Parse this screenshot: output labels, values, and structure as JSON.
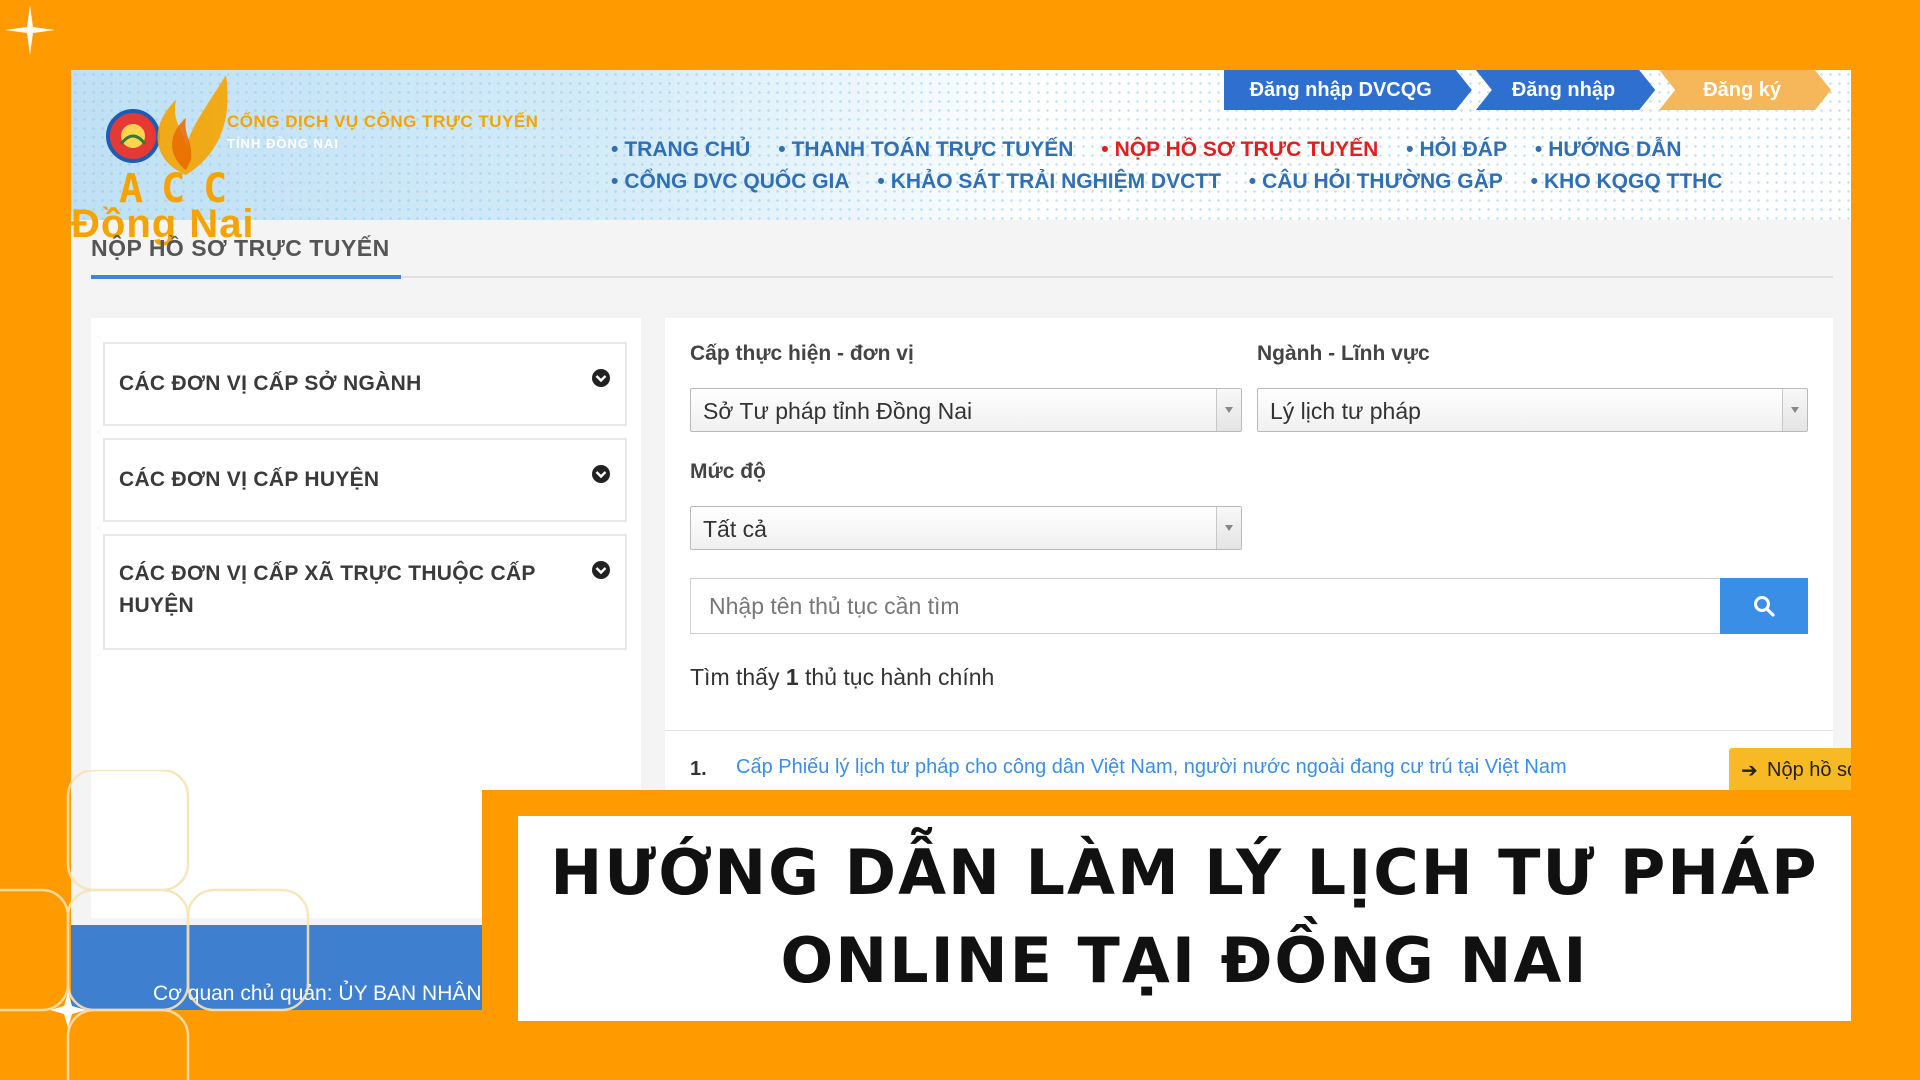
{
  "brand": {
    "portal_name": "CỔNG DỊCH VỤ CÔNG TRỰC TUYẾN",
    "portal_sub": "TỈNH ĐỒNG NAI",
    "watermark_line1": "ACC",
    "watermark_line2": "Đồng Nai",
    "accent_orange": "#ff9a00",
    "link_blue": "#2f6fb5"
  },
  "auth": {
    "login_dvcqg": "Đăng nhập DVCQG",
    "login": "Đăng nhập",
    "register": "Đăng ký"
  },
  "nav": {
    "row1": [
      {
        "label": "TRANG CHỦ"
      },
      {
        "label": "THANH TOÁN TRỰC TUYẾN"
      },
      {
        "label": "NỘP HỒ SƠ TRỰC TUYẾN",
        "active": true
      },
      {
        "label": "HỎI ĐÁP"
      },
      {
        "label": "HƯỚNG DẪN"
      }
    ],
    "row2": [
      {
        "label": "CỔNG DVC QUỐC GIA"
      },
      {
        "label": "KHẢO SÁT TRẢI NGHIỆM DVCTT"
      },
      {
        "label": "CÂU HỎI THƯỜNG GẶP"
      },
      {
        "label": "KHO KQGQ TTHC"
      }
    ]
  },
  "page": {
    "title": "NỘP HỒ SƠ TRỰC TUYẾN"
  },
  "units": [
    {
      "label": "CÁC ĐƠN VỊ CẤP SỞ NGÀNH",
      "icon": "chevron-circle-down-icon"
    },
    {
      "label": "CÁC ĐƠN VỊ CẤP HUYỆN",
      "icon": "chevron-circle-down-icon"
    },
    {
      "label": "CÁC ĐƠN VỊ CẤP XÃ TRỰC THUỘC CẤP HUYỆN",
      "icon": "chevron-circle-down-icon"
    }
  ],
  "filters": {
    "level_label": "Cấp thực hiện - đơn vị",
    "level_value": "Sở Tư pháp tỉnh Đồng Nai",
    "field_label": "Ngành - Lĩnh vực",
    "field_value": "Lý lịch tư pháp",
    "degree_label": "Mức độ",
    "degree_value": "Tất cả"
  },
  "search": {
    "placeholder": "Nhập tên thủ tục cần tìm",
    "icon": "search-icon"
  },
  "results": {
    "prefix": "Tìm thấy",
    "count": "1",
    "suffix": "thủ tục hành chính",
    "items": [
      {
        "index": "1.",
        "title": "Cấp Phiếu lý lịch tư pháp cho công dân Việt Nam, người nước ngoài đang cư trú tại Việt Nam",
        "action_label": "Nộp hồ sơ",
        "action_icon": "arrow-right-icon"
      }
    ]
  },
  "footer": {
    "text": "Cơ quan chủ quản: ỦY BAN NHÂN"
  },
  "caption": {
    "line1": "HƯỚNG DẪN LÀM LÝ LỊCH TƯ PHÁP",
    "line2": "ONLINE TẠI ĐỒNG NAI"
  }
}
